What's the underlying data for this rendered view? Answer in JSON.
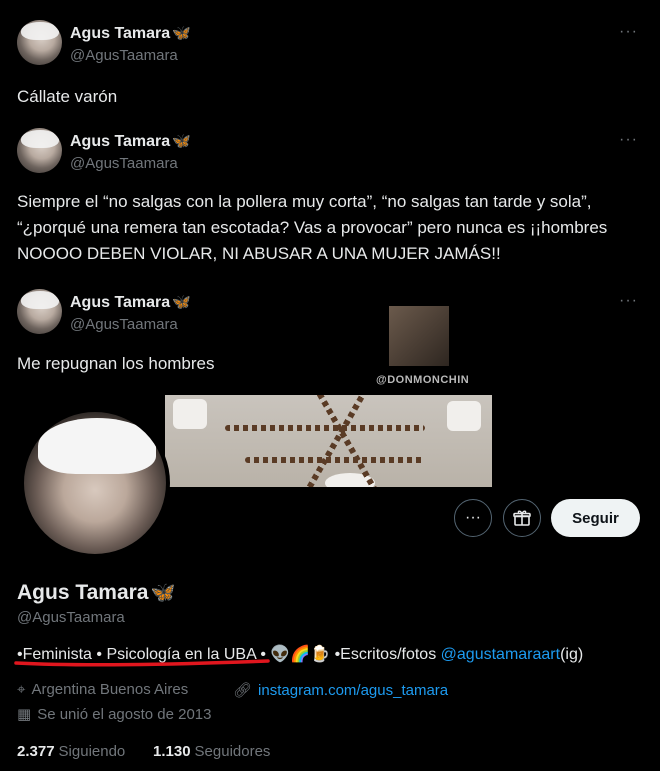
{
  "tweets": [
    {
      "name": "Agus Tamara",
      "handle": "@AgusTaamara",
      "text": "Cállate varón"
    },
    {
      "name": "Agus Tamara",
      "handle": "@AgusTaamara",
      "text": "Siempre el “no salgas con la pollera muy corta”, “no salgas tan tarde y sola”, “¿porqué una remera tan escotada? Vas a provocar” pero nunca es ¡¡hombres NOOOO DEBEN VIOLAR, NI ABUSAR A UNA MUJER JAMÁS!!"
    },
    {
      "name": "Agus Tamara",
      "handle": "@AgusTaamara",
      "text": "Me repugnan los hombres"
    }
  ],
  "more_label": "···",
  "butterfly": "🦋",
  "watermark": "@DONMONCHIN",
  "profile": {
    "name": "Agus Tamara",
    "handle": "@AgusTaamara",
    "follow_label": "Seguir",
    "more_label": "···",
    "bio_prefix": "•Feminista • Psicología en la UBA • 👽🌈🍺 •Escritos/fotos ",
    "bio_link": "@agustamaraart",
    "bio_suffix": "(ig)",
    "location": "Argentina Buenos Aires",
    "website": "instagram.com/agus_tamara",
    "joined": "Se unió el agosto de 2013",
    "following_count": "2.377",
    "following_label": "Siguiendo",
    "followers_count": "1.130",
    "followers_label": "Seguidores"
  },
  "colors": {
    "accent": "#1d9bf0",
    "muted": "#71767b",
    "underline": "#e0161e"
  }
}
